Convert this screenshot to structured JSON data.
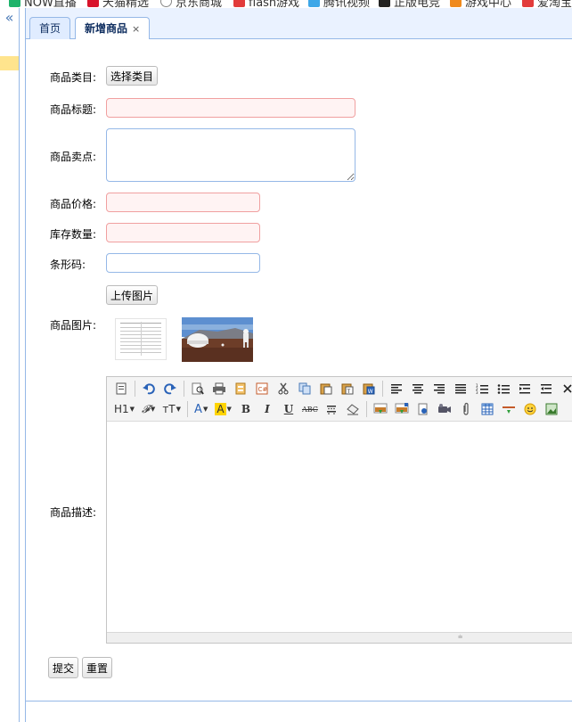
{
  "bookmarks": [
    {
      "label": "NOW直播",
      "color": "#1db36b"
    },
    {
      "label": "天猫精选",
      "color": "#d8132b"
    },
    {
      "label": "京东商城",
      "color": "#888888"
    },
    {
      "label": "flash游戏",
      "color": "#e23b3b"
    },
    {
      "label": "腾讯视频",
      "color": "#3da7e8"
    },
    {
      "label": "正版电竞",
      "color": "#222222"
    },
    {
      "label": "游戏中心",
      "color": "#f08a1c"
    },
    {
      "label": "爱淘宝",
      "color": "#e23b3b"
    }
  ],
  "sidebar": {
    "collapse_icon": "«"
  },
  "tabs": [
    {
      "label": "首页"
    },
    {
      "label": "新增商品",
      "close": "×"
    }
  ],
  "form": {
    "category": {
      "label": "商品类目:",
      "button": "选择类目"
    },
    "title": {
      "label": "商品标题:",
      "value": ""
    },
    "selling_point": {
      "label": "商品卖点:",
      "value": ""
    },
    "price": {
      "label": "商品价格:",
      "value": ""
    },
    "stock": {
      "label": "库存数量:",
      "value": ""
    },
    "barcode": {
      "label": "条形码:",
      "value": ""
    },
    "images": {
      "label": "商品图片:",
      "upload_button": "上传图片"
    },
    "description": {
      "label": "商品描述:"
    },
    "submit": "提交",
    "reset": "重置"
  },
  "editor": {
    "toolbar_row1": [
      "source-icon",
      "undo-icon",
      "redo-icon",
      "preview-icon",
      "print-icon",
      "template-icon",
      "code-icon",
      "cut-icon",
      "copy-icon",
      "paste-icon",
      "paste-plain-icon",
      "paste-word-icon",
      "align-left-icon",
      "align-center-icon",
      "align-right-icon",
      "align-justify-icon",
      "ordered-list-icon",
      "unordered-list-icon",
      "indent-icon",
      "outdent-icon",
      "close-icon"
    ],
    "toolbar_row2_labels": {
      "heading": "H1",
      "font_family": "𝓕",
      "font_size": "тT",
      "font_color": "A",
      "highlight": "A",
      "bold": "B",
      "italic": "I",
      "underline": "U",
      "strike": "ABC"
    },
    "colors": {
      "highlight": "#ffd400",
      "accent": "#2a63b8"
    }
  },
  "colors": {
    "border": "#95b8e7",
    "tab_bg": "#e0ecff",
    "invalid_bg": "#fff3f3",
    "invalid_border": "#f0a0a0"
  }
}
